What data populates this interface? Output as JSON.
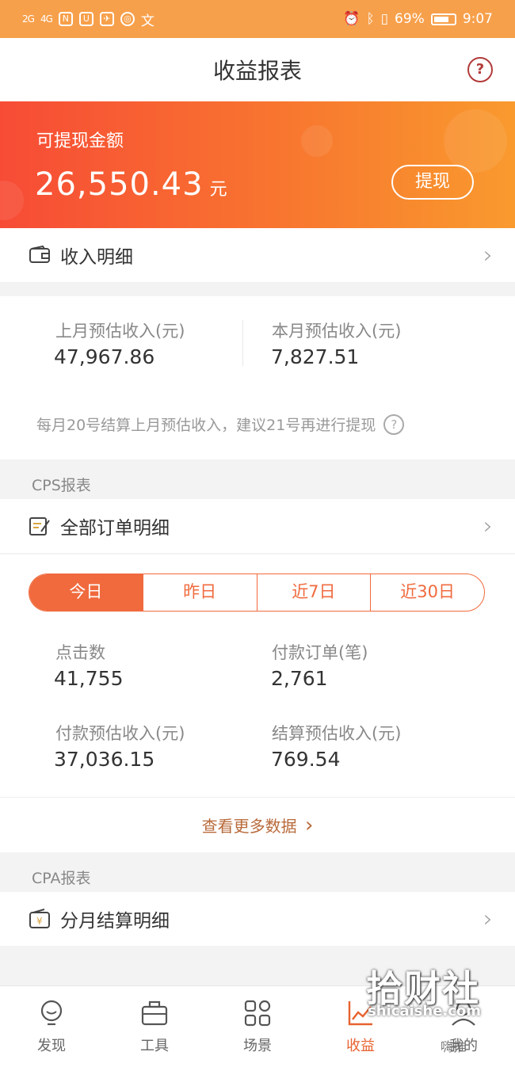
{
  "status_bar": {
    "signal1": "2G",
    "signal2": "4G",
    "battery": "69%",
    "time": "9:07"
  },
  "nav": {
    "title": "收益报表",
    "help": "?"
  },
  "banner": {
    "label": "可提现金额",
    "amount": "26,550.43",
    "unit": "元",
    "withdraw": "提现"
  },
  "income_detail": {
    "label": "收入明细"
  },
  "estimate": {
    "last_month_label": "上月预估收入(元)",
    "last_month_value": "47,967.86",
    "this_month_label": "本月预估收入(元)",
    "this_month_value": "7,827.51",
    "note": "每月20号结算上月预估收入，建议21号再进行提现",
    "note_help": "?"
  },
  "cps": {
    "section_title": "CPS报表",
    "all_orders_label": "全部订单明细",
    "tabs": [
      {
        "label": "今日",
        "active": true
      },
      {
        "label": "昨日",
        "active": false
      },
      {
        "label": "近7日",
        "active": false
      },
      {
        "label": "近30日",
        "active": false
      }
    ],
    "clicks_label": "点击数",
    "clicks_value": "41,755",
    "paid_orders_label": "付款订单(笔)",
    "paid_orders_value": "2,761",
    "paid_income_label": "付款预估收入(元)",
    "paid_income_value": "37,036.15",
    "settled_income_label": "结算预估收入(元)",
    "settled_income_value": "769.54",
    "more": "查看更多数据"
  },
  "cpa": {
    "section_title": "CPA报表",
    "monthly_label": "分月结算明细"
  },
  "tabbar": {
    "items": [
      {
        "label": "发现",
        "icon": "bulb-icon"
      },
      {
        "label": "工具",
        "icon": "briefcase-icon"
      },
      {
        "label": "场景",
        "icon": "grid-icon"
      },
      {
        "label": "收益",
        "icon": "chart-icon"
      },
      {
        "label": "我的",
        "icon": "user-icon"
      }
    ]
  },
  "watermark": {
    "main": "拾财社",
    "sub": "shicaishe.com",
    "tag": "嗨推"
  }
}
